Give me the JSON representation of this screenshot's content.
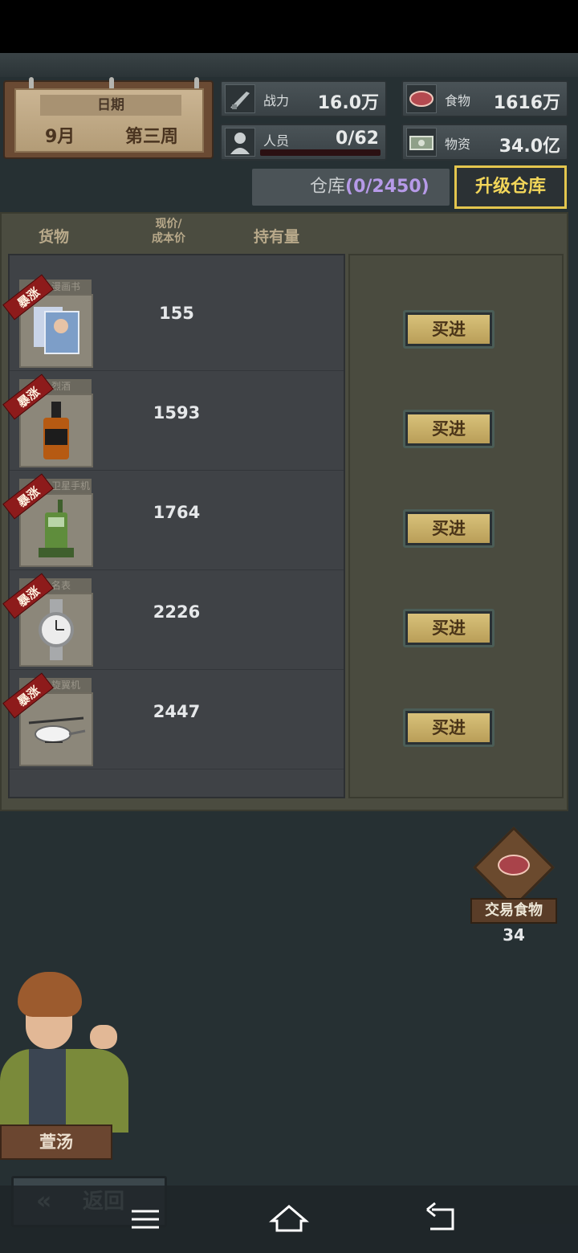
{
  "date": {
    "title": "日期",
    "month": "9月",
    "week": "第三周"
  },
  "stats": {
    "power": {
      "label": "战力",
      "value": "16.0万"
    },
    "food": {
      "label": "食物",
      "value": "1616万"
    },
    "personnel": {
      "label": "人员",
      "value": "0/62"
    },
    "supplies": {
      "label": "物资",
      "value": "34.0亿"
    }
  },
  "warehouse": {
    "label": "仓库",
    "open": "(",
    "count": "0/2450",
    "close": ")"
  },
  "upgrade_label": "升级仓库",
  "columns": {
    "goods": "货物",
    "price_line1": "现价/",
    "price_line2": "成本价",
    "holding": "持有量"
  },
  "items": [
    {
      "tag": "漫画书",
      "surge": "暴涨",
      "price": "155",
      "buy": "买进",
      "icon": "comic-book-icon"
    },
    {
      "tag": "烈酒",
      "surge": "暴涨",
      "price": "1593",
      "buy": "买进",
      "icon": "whiskey-bottle-icon"
    },
    {
      "tag": "卫星手机",
      "surge": "暴涨",
      "price": "1764",
      "buy": "买进",
      "icon": "satellite-phone-icon"
    },
    {
      "tag": "名表",
      "surge": "暴涨",
      "price": "2226",
      "buy": "买进",
      "icon": "wristwatch-icon"
    },
    {
      "tag": "旋翼机",
      "surge": "暴涨",
      "price": "2447",
      "buy": "买进",
      "icon": "gyrocopter-icon"
    }
  ],
  "trade": {
    "label": "交易食物",
    "count": "34"
  },
  "npc": {
    "name": "萱汤"
  },
  "back_label": "返回"
}
